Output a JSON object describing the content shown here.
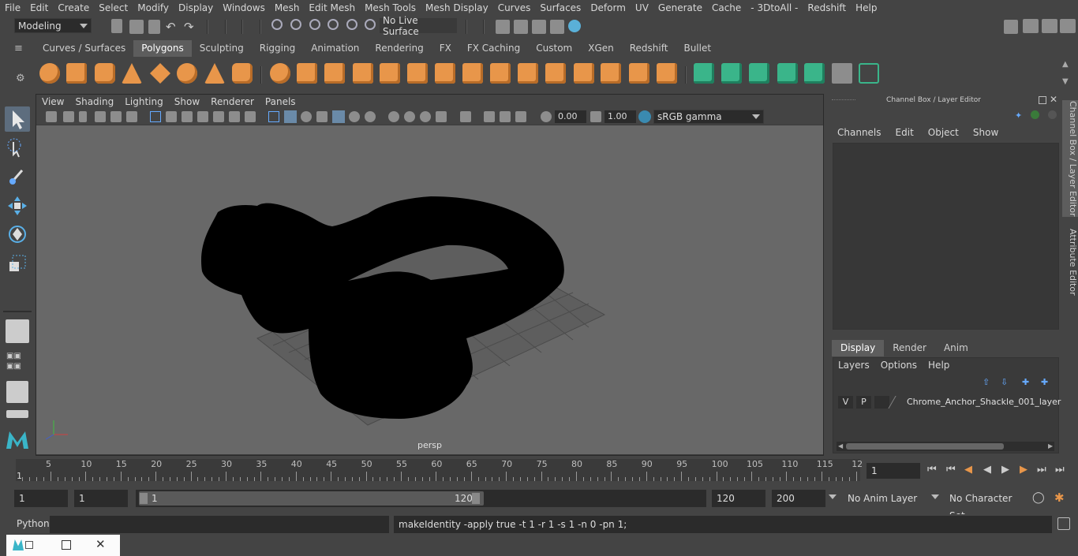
{
  "menubar": [
    "File",
    "Edit",
    "Create",
    "Select",
    "Modify",
    "Display",
    "Windows",
    "Mesh",
    "Edit Mesh",
    "Mesh Tools",
    "Mesh Display",
    "Curves",
    "Surfaces",
    "Deform",
    "UV",
    "Generate",
    "Cache",
    "- 3DtoAll -",
    "Redshift",
    "Help"
  ],
  "status": {
    "mode": "Modeling",
    "live_surface": "No Live Surface"
  },
  "shelf_tabs": [
    "Curves / Surfaces",
    "Polygons",
    "Sculpting",
    "Rigging",
    "Animation",
    "Rendering",
    "FX",
    "FX Caching",
    "Custom",
    "XGen",
    "Redshift",
    "Bullet"
  ],
  "shelf_active": "Polygons",
  "viewport": {
    "menus": [
      "View",
      "Shading",
      "Lighting",
      "Show",
      "Renderer",
      "Panels"
    ],
    "exposure": "0.00",
    "gamma": "1.00",
    "color_space": "sRGB gamma",
    "camera_label": "persp"
  },
  "channel_box": {
    "title": "Channel Box / Layer Editor",
    "menus": [
      "Channels",
      "Edit",
      "Object",
      "Show"
    ]
  },
  "layer_editor": {
    "tabs": [
      "Display",
      "Render",
      "Anim"
    ],
    "active_tab": "Display",
    "menus": [
      "Layers",
      "Options",
      "Help"
    ],
    "layer": {
      "v": "V",
      "p": "P",
      "name": "Chrome_Anchor_Shackle_001_layer"
    }
  },
  "side_tabs": [
    "Channel Box / Layer Editor",
    "Attribute Editor"
  ],
  "timeline": {
    "ticks": [
      5,
      10,
      15,
      20,
      25,
      30,
      35,
      40,
      45,
      50,
      55,
      60,
      65,
      70,
      75,
      80,
      85,
      90,
      95,
      100,
      105,
      110,
      115,
      12
    ],
    "start_marker": "1",
    "current_frame": "1"
  },
  "range": {
    "start": "1",
    "playback_start": "1",
    "slider_start": "1",
    "slider_end": "120",
    "playback_end": "120",
    "end": "200",
    "anim_layer": "No Anim Layer",
    "character_set": "No Character Set"
  },
  "command": {
    "language": "Python",
    "output": "makeIdentity -apply true -t 1 -r 1 -s 1 -n 0 -pn 1;"
  },
  "colors": {
    "accent_orange": "#e8964a",
    "accent_green": "#3ab58a",
    "selected_blue": "#5d6d7e"
  }
}
